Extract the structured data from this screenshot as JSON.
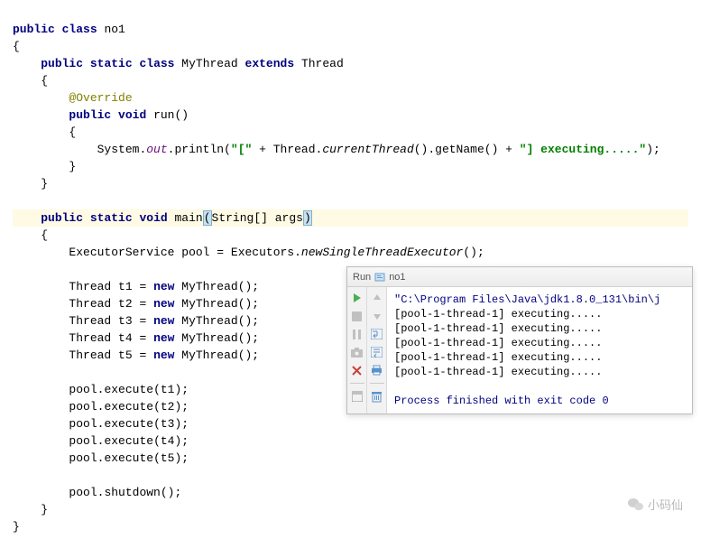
{
  "code": {
    "kw_public": "public",
    "kw_class": "class",
    "kw_static": "static",
    "kw_extends": "extends",
    "kw_void": "void",
    "kw_new": "new",
    "cls_no1": "no1",
    "cls_MyThread": "MyThread",
    "cls_Thread": "Thread",
    "cls_String": "String",
    "cls_ExecutorService": "ExecutorService",
    "cls_Executors": "Executors",
    "ann_Override": "@Override",
    "m_run": "run",
    "m_main": "main",
    "id_System": "System",
    "id_out": "out",
    "m_println": "println",
    "m_currentThread": "currentThread",
    "m_getName": "getName",
    "m_newSingleThreadExecutor": "newSingleThreadExecutor",
    "m_execute": "execute",
    "m_shutdown": "shutdown",
    "id_pool": "pool",
    "id_args": "args",
    "t1": "t1",
    "t2": "t2",
    "t3": "t3",
    "t4": "t4",
    "t5": "t5",
    "str_open": "\"[\"",
    "str_close": "\"] executing.....\""
  },
  "run": {
    "tab_label": "Run",
    "config_name": "no1",
    "output_path": "\"C:\\Program Files\\Java\\jdk1.8.0_131\\bin\\j",
    "lines": [
      "[pool-1-thread-1] executing.....",
      "[pool-1-thread-1] executing.....",
      "[pool-1-thread-1] executing.....",
      "[pool-1-thread-1] executing.....",
      "[pool-1-thread-1] executing....."
    ],
    "exit_msg": "Process finished with exit code 0"
  },
  "watermark": {
    "text": "小码仙"
  }
}
